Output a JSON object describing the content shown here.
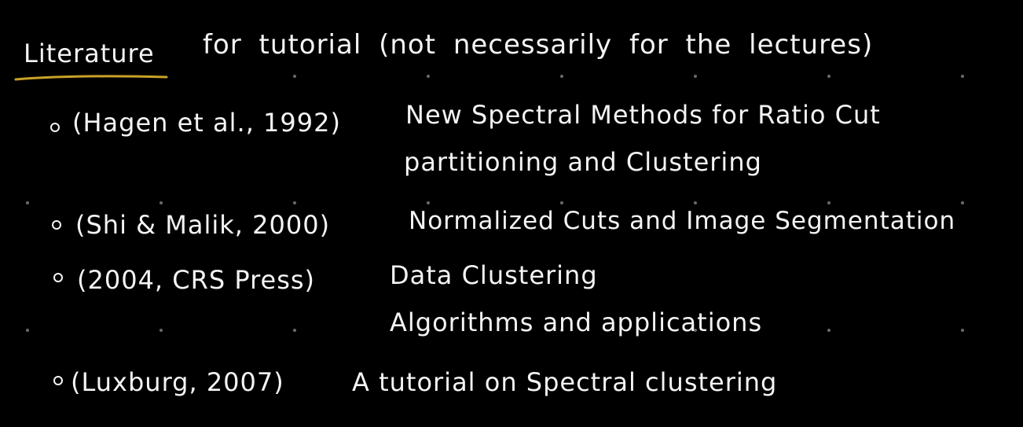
{
  "heading": {
    "word": "Literature",
    "rest": "for tutorial (not necessarily for the lectures)"
  },
  "colors": {
    "background": "#000000",
    "ink": "#f4f4f4",
    "underline": "#c9a227",
    "grid_dot": "#6a6a6a"
  },
  "references": [
    {
      "citation": "(Hagen et al., 1992)",
      "title_lines": [
        "New Spectral Methods for Ratio Cut",
        "partitioning and Clustering"
      ]
    },
    {
      "citation": "(Shi & Malik, 2000)",
      "title_lines": [
        "Normalized Cuts and Image Segmentation"
      ]
    },
    {
      "citation": "(2004, CRS Press)",
      "title_lines": [
        "Data Clustering",
        "Algorithms and applications"
      ]
    },
    {
      "citation": "(Luxburg, 2007)",
      "title_lines": [
        "A tutorial on Spectral clustering"
      ]
    }
  ]
}
